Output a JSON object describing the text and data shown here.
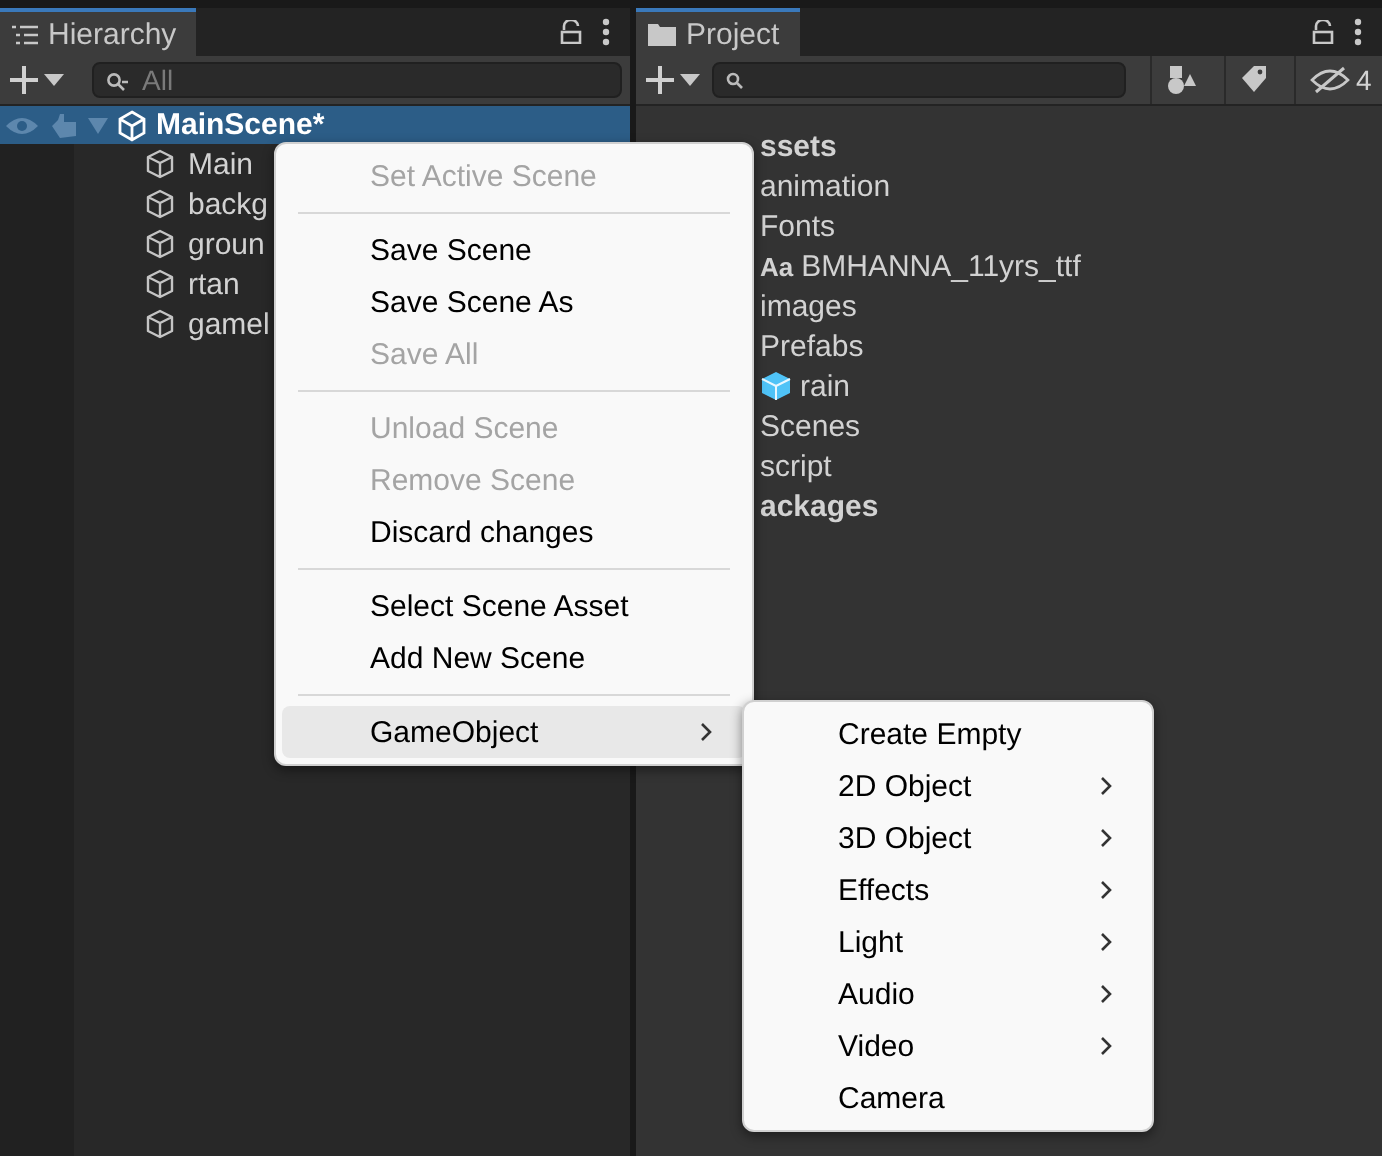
{
  "hierarchy": {
    "tab": {
      "label": "Hierarchy",
      "selected": true
    },
    "search": {
      "placeholder": "All"
    },
    "scene": {
      "label": "MainScene*",
      "selected": true
    },
    "objects": [
      {
        "label": "Main"
      },
      {
        "label": "backg"
      },
      {
        "label": "groun"
      },
      {
        "label": "rtan"
      },
      {
        "label": "gamel"
      }
    ]
  },
  "project": {
    "tab": {
      "label": "Project",
      "selected": true
    },
    "hidden_count": "4",
    "items": [
      {
        "label": "ssets",
        "kind": "root"
      },
      {
        "label": "animation",
        "kind": "folder"
      },
      {
        "label": "Fonts",
        "kind": "folder"
      },
      {
        "label": "BMHANNA_11yrs_ttf",
        "kind": "font",
        "badge": "Aa"
      },
      {
        "label": "images",
        "kind": "folder"
      },
      {
        "label": "Prefabs",
        "kind": "folder"
      },
      {
        "label": "rain",
        "kind": "prefab"
      },
      {
        "label": "Scenes",
        "kind": "folder"
      },
      {
        "label": "script",
        "kind": "folder"
      },
      {
        "label": "ackages",
        "kind": "root"
      }
    ]
  },
  "context_menu": [
    {
      "kind": "item",
      "label": "Set Active Scene",
      "disabled": true,
      "selected": false
    },
    {
      "kind": "separator"
    },
    {
      "kind": "item",
      "label": "Save Scene",
      "disabled": false,
      "selected": false
    },
    {
      "kind": "item",
      "label": "Save Scene As",
      "disabled": false,
      "selected": false
    },
    {
      "kind": "item",
      "label": "Save All",
      "disabled": true,
      "selected": false
    },
    {
      "kind": "separator"
    },
    {
      "kind": "item",
      "label": "Unload Scene",
      "disabled": true,
      "selected": false
    },
    {
      "kind": "item",
      "label": "Remove Scene",
      "disabled": true,
      "selected": false
    },
    {
      "kind": "item",
      "label": "Discard changes",
      "disabled": false,
      "selected": false
    },
    {
      "kind": "separator"
    },
    {
      "kind": "item",
      "label": "Select Scene Asset",
      "disabled": false,
      "selected": false
    },
    {
      "kind": "item",
      "label": "Add New Scene",
      "disabled": false,
      "selected": false
    },
    {
      "kind": "separator"
    },
    {
      "kind": "submenu",
      "label": "GameObject",
      "disabled": false,
      "selected": true
    }
  ],
  "submenu": [
    {
      "kind": "item",
      "label": "Create Empty"
    },
    {
      "kind": "submenu",
      "label": "2D Object"
    },
    {
      "kind": "submenu",
      "label": "3D Object"
    },
    {
      "kind": "submenu",
      "label": "Effects"
    },
    {
      "kind": "submenu",
      "label": "Light"
    },
    {
      "kind": "submenu",
      "label": "Audio"
    },
    {
      "kind": "submenu",
      "label": "Video"
    },
    {
      "kind": "item",
      "label": "Camera"
    }
  ]
}
